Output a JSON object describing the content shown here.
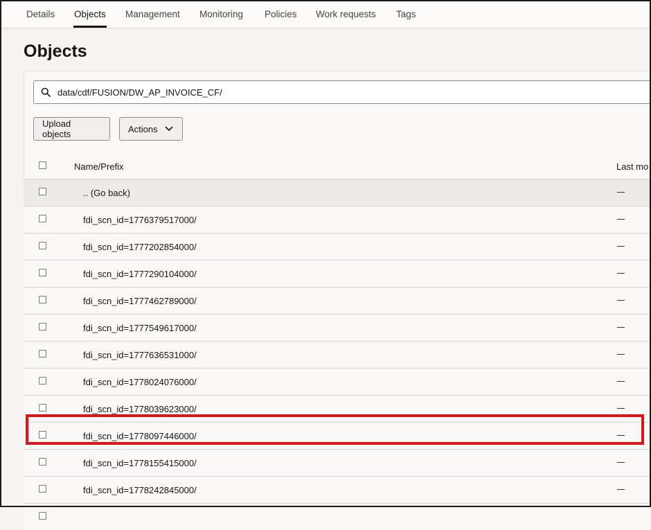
{
  "tabs": [
    {
      "label": "Details"
    },
    {
      "label": "Objects"
    },
    {
      "label": "Management"
    },
    {
      "label": "Monitoring"
    },
    {
      "label": "Policies"
    },
    {
      "label": "Work requests"
    },
    {
      "label": "Tags"
    }
  ],
  "active_tab": "Objects",
  "page_title": "Objects",
  "search": {
    "value": "data/cdf/FUSION/DW_AP_INVOICE_CF/"
  },
  "toolbar": {
    "upload_label": "Upload objects",
    "actions_label": "Actions"
  },
  "table": {
    "columns": [
      "Name/Prefix",
      "Last mo"
    ],
    "rows": [
      {
        "name": ".. (Go back)",
        "last_modified": "—"
      },
      {
        "name": "fdi_scn_id=1776379517000/",
        "last_modified": "—"
      },
      {
        "name": "fdi_scn_id=1777202854000/",
        "last_modified": "—"
      },
      {
        "name": "fdi_scn_id=1777290104000/",
        "last_modified": "—"
      },
      {
        "name": "fdi_scn_id=1777462789000/",
        "last_modified": "—"
      },
      {
        "name": "fdi_scn_id=1777549617000/",
        "last_modified": "—"
      },
      {
        "name": "fdi_scn_id=1777636531000/",
        "last_modified": "—"
      },
      {
        "name": "fdi_scn_id=1778024076000/",
        "last_modified": "—"
      },
      {
        "name": "fdi_scn_id=1778039623000/",
        "last_modified": "—"
      },
      {
        "name": "fdi_scn_id=1778097446000/",
        "last_modified": "—"
      },
      {
        "name": "fdi_scn_id=1778155415000/",
        "last_modified": "—"
      },
      {
        "name": "fdi_scn_id=1778242845000/",
        "last_modified": "—"
      }
    ]
  },
  "highlighted_row": "fdi_scn_id=1778097446000/",
  "colors": {
    "highlight": "#d9161b",
    "accent": "#161513"
  }
}
